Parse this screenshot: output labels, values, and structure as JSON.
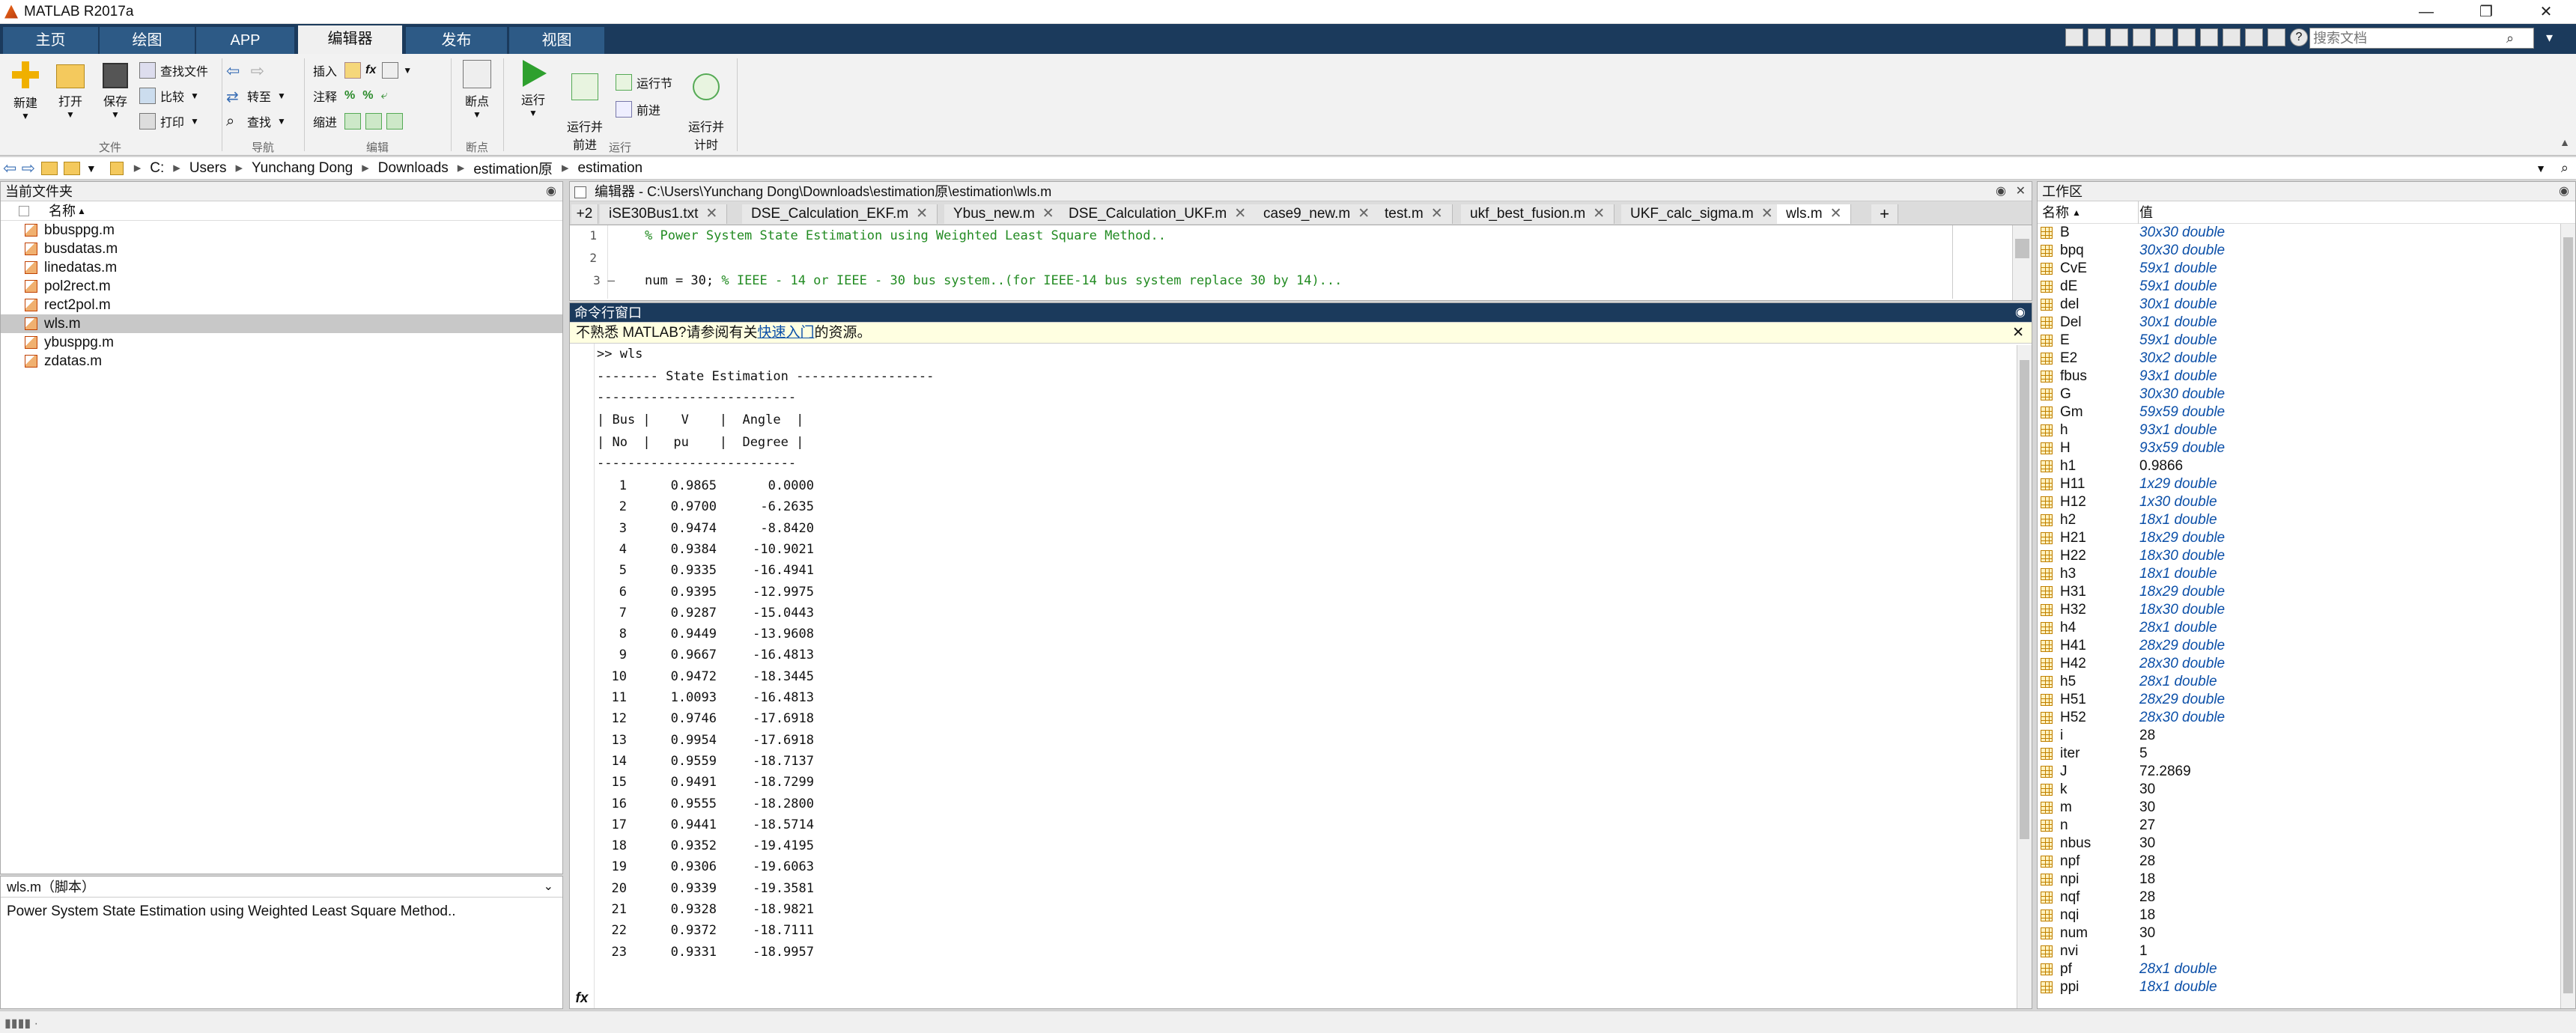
{
  "window": {
    "title": "MATLAB R2017a",
    "controls": [
      "—",
      "❐",
      "✕"
    ]
  },
  "tabs": [
    {
      "label": "主页",
      "active": false
    },
    {
      "label": "绘图",
      "active": false
    },
    {
      "label": "APP",
      "active": false
    },
    {
      "label": "编辑器",
      "active": true
    },
    {
      "label": "发布",
      "active": false
    },
    {
      "label": "视图",
      "active": false
    }
  ],
  "search": {
    "placeholder": "搜索文档"
  },
  "ribbon": {
    "new": "新建",
    "open": "打开",
    "save": "保存",
    "find_files": "查找文件",
    "compare": "比较",
    "print": "打印",
    "goto": "转至",
    "find": "查找",
    "insert": "插入",
    "comment": "注释",
    "indent": "缩进",
    "fx": "fx",
    "breakpoints": "断点",
    "run": "运行",
    "run_advance": "运行并\n前进",
    "run_section": "运行节",
    "advance": "前进",
    "run_time": "运行并\n计时",
    "sections": {
      "file": "文件",
      "nav": "导航",
      "edit": "编辑",
      "bp": "断点",
      "run": "运行"
    }
  },
  "address": {
    "parts": [
      "C:",
      "Users",
      "Yunchang Dong",
      "Downloads",
      "estimation原",
      "estimation"
    ]
  },
  "files": {
    "header": "当前文件夹",
    "col": "名称",
    "items": [
      "bbusppg.m",
      "busdatas.m",
      "linedatas.m",
      "pol2rect.m",
      "rect2pol.m",
      "wls.m",
      "ybusppg.m",
      "zdatas.m"
    ],
    "selected": "wls.m",
    "detail_title": "wls.m（脚本）",
    "detail_text": "Power System State Estimation using Weighted Least Square Method.."
  },
  "editor": {
    "header": "编辑器 - C:\\Users\\Yunchang Dong\\Downloads\\estimation原\\estimation\\wls.m",
    "overflow": "+2",
    "tabs": [
      "iSE30Bus1.txt",
      "DSE_Calculation_EKF.m",
      "Ybus_new.m",
      "DSE_Calculation_UKF.m",
      "case9_new.m",
      "test.m",
      "ukf_best_fusion.m",
      "UKF_calc_sigma.m",
      "wls.m"
    ],
    "active_tab": "wls.m",
    "add_tab": "+",
    "lines": [
      {
        "num": "1",
        "code": "",
        "comment": "% Power System State Estimation using Weighted Least Square Method.."
      },
      {
        "num": "2",
        "code": "",
        "comment": ""
      },
      {
        "num": "3 —",
        "code": "num = 30; ",
        "comment": "% IEEE - 14 or IEEE - 30 bus system..(for IEEE-14 bus system replace 30 by 14)..."
      }
    ]
  },
  "command": {
    "header": "命令行窗口",
    "notice_prefix": "不熟悉 MATLAB?请参阅有关",
    "notice_link": "快速入门",
    "notice_suffix": "的资源。",
    "prompt": ">> wls",
    "title_line": "-------- State Estimation ------------------",
    "sep": "--------------------------",
    "head1": "| Bus |    V    |  Angle  |",
    "head2": "| No  |   pu    |  Degree |",
    "rows": [
      [
        "1",
        "0.9865",
        "0.0000"
      ],
      [
        "2",
        "0.9700",
        "-6.2635"
      ],
      [
        "3",
        "0.9474",
        "-8.8420"
      ],
      [
        "4",
        "0.9384",
        "-10.9021"
      ],
      [
        "5",
        "0.9335",
        "-16.4941"
      ],
      [
        "6",
        "0.9395",
        "-12.9975"
      ],
      [
        "7",
        "0.9287",
        "-15.0443"
      ],
      [
        "8",
        "0.9449",
        "-13.9608"
      ],
      [
        "9",
        "0.9667",
        "-16.4813"
      ],
      [
        "10",
        "0.9472",
        "-18.3445"
      ],
      [
        "11",
        "1.0093",
        "-16.4813"
      ],
      [
        "12",
        "0.9746",
        "-17.6918"
      ],
      [
        "13",
        "0.9954",
        "-17.6918"
      ],
      [
        "14",
        "0.9559",
        "-18.7137"
      ],
      [
        "15",
        "0.9491",
        "-18.7299"
      ],
      [
        "16",
        "0.9555",
        "-18.2800"
      ],
      [
        "17",
        "0.9441",
        "-18.5714"
      ],
      [
        "18",
        "0.9352",
        "-19.4195"
      ],
      [
        "19",
        "0.9306",
        "-19.6063"
      ],
      [
        "20",
        "0.9339",
        "-19.3581"
      ],
      [
        "21",
        "0.9328",
        "-18.9821"
      ],
      [
        "22",
        "0.9372",
        "-18.7111"
      ],
      [
        "23",
        "0.9331",
        "-18.9957"
      ]
    ],
    "fx": "fx"
  },
  "workspace": {
    "header": "工作区",
    "col_name": "名称",
    "col_value": "值",
    "vars": [
      {
        "name": "B",
        "value": "30x30 double",
        "matrix": true
      },
      {
        "name": "bpq",
        "value": "30x30 double",
        "matrix": true
      },
      {
        "name": "CvE",
        "value": "59x1 double",
        "matrix": true
      },
      {
        "name": "dE",
        "value": "59x1 double",
        "matrix": true
      },
      {
        "name": "del",
        "value": "30x1 double",
        "matrix": true
      },
      {
        "name": "Del",
        "value": "30x1 double",
        "matrix": true
      },
      {
        "name": "E",
        "value": "59x1 double",
        "matrix": true
      },
      {
        "name": "E2",
        "value": "30x2 double",
        "matrix": true
      },
      {
        "name": "fbus",
        "value": "93x1 double",
        "matrix": true
      },
      {
        "name": "G",
        "value": "30x30 double",
        "matrix": true
      },
      {
        "name": "Gm",
        "value": "59x59 double",
        "matrix": true
      },
      {
        "name": "h",
        "value": "93x1 double",
        "matrix": true
      },
      {
        "name": "H",
        "value": "93x59 double",
        "matrix": true
      },
      {
        "name": "h1",
        "value": "0.9866",
        "matrix": false
      },
      {
        "name": "H11",
        "value": "1x29 double",
        "matrix": true
      },
      {
        "name": "H12",
        "value": "1x30 double",
        "matrix": true
      },
      {
        "name": "h2",
        "value": "18x1 double",
        "matrix": true
      },
      {
        "name": "H21",
        "value": "18x29 double",
        "matrix": true
      },
      {
        "name": "H22",
        "value": "18x30 double",
        "matrix": true
      },
      {
        "name": "h3",
        "value": "18x1 double",
        "matrix": true
      },
      {
        "name": "H31",
        "value": "18x29 double",
        "matrix": true
      },
      {
        "name": "H32",
        "value": "18x30 double",
        "matrix": true
      },
      {
        "name": "h4",
        "value": "28x1 double",
        "matrix": true
      },
      {
        "name": "H41",
        "value": "28x29 double",
        "matrix": true
      },
      {
        "name": "H42",
        "value": "28x30 double",
        "matrix": true
      },
      {
        "name": "h5",
        "value": "28x1 double",
        "matrix": true
      },
      {
        "name": "H51",
        "value": "28x29 double",
        "matrix": true
      },
      {
        "name": "H52",
        "value": "28x30 double",
        "matrix": true
      },
      {
        "name": "i",
        "value": "28",
        "matrix": false
      },
      {
        "name": "iter",
        "value": "5",
        "matrix": false
      },
      {
        "name": "J",
        "value": "72.2869",
        "matrix": false
      },
      {
        "name": "k",
        "value": "30",
        "matrix": false
      },
      {
        "name": "m",
        "value": "30",
        "matrix": false
      },
      {
        "name": "n",
        "value": "27",
        "matrix": false
      },
      {
        "name": "nbus",
        "value": "30",
        "matrix": false
      },
      {
        "name": "npf",
        "value": "28",
        "matrix": false
      },
      {
        "name": "npi",
        "value": "18",
        "matrix": false
      },
      {
        "name": "nqf",
        "value": "28",
        "matrix": false
      },
      {
        "name": "nqi",
        "value": "18",
        "matrix": false
      },
      {
        "name": "num",
        "value": "30",
        "matrix": false
      },
      {
        "name": "nvi",
        "value": "1",
        "matrix": false
      },
      {
        "name": "pf",
        "value": "28x1 double",
        "matrix": true
      },
      {
        "name": "ppi",
        "value": "18x1 double",
        "matrix": true
      }
    ]
  },
  "colors": {
    "tabbar": "#1b3a5c",
    "accent": "#0b4fa8",
    "comment": "#228b22"
  }
}
